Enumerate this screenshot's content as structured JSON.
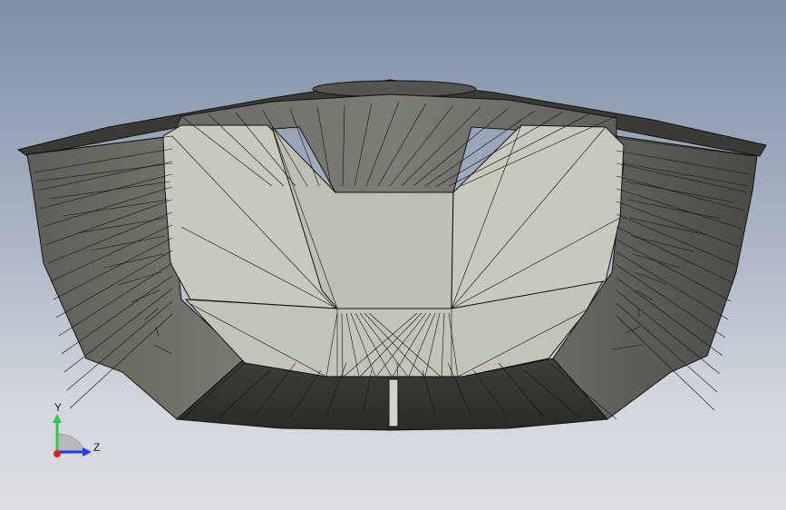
{
  "viewport": {
    "background_top": "#7f8fa8",
    "background_bottom": "#dcdee2",
    "model_colors": {
      "mesh_line": "#111111",
      "dark_face": "#4a4a46",
      "mid_face": "#6e6e68",
      "light_face": "#c9c9bd"
    }
  },
  "triad": {
    "y_label": "Y",
    "z_label": "Z",
    "y_color": "#2ecc40",
    "z_color": "#1e3cff",
    "x_color": "#e02020"
  }
}
